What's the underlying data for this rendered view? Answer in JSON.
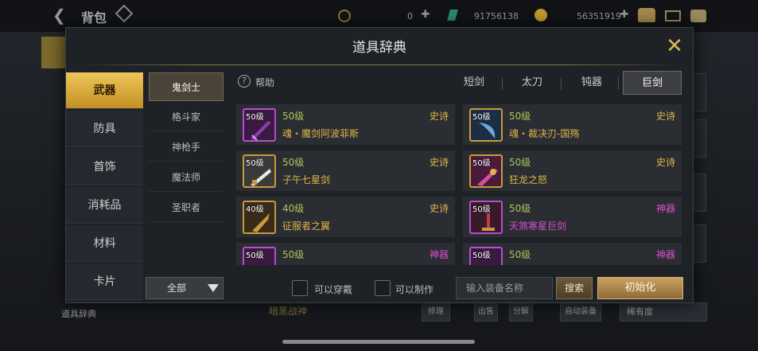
{
  "topbar": {
    "title": "背包",
    "currency_1": "0",
    "currency_2": "91756138",
    "currency_3": "56351919"
  },
  "background": {
    "bottom_left_label": "道具辞典",
    "bottom_label_2": "暗黑战神",
    "buttons": [
      "修理",
      "出售",
      "分解",
      "自动装备"
    ],
    "sort_label": "稀有度"
  },
  "dialog": {
    "title": "道具辞典",
    "categories": [
      "武器",
      "防具",
      "首饰",
      "消耗品",
      "材料",
      "卡片"
    ],
    "active_category": "武器",
    "classes": [
      "鬼剑士",
      "格斗家",
      "神枪手",
      "魔法师",
      "圣职者"
    ],
    "active_class": "鬼剑士",
    "help_label": "帮助",
    "weapon_tabs": [
      "短剑",
      "太刀",
      "钝器",
      "巨剑"
    ],
    "active_weapon_tab": "巨剑",
    "items": [
      {
        "level_badge": "50级",
        "level": "50级",
        "grade": "史诗",
        "name": "魂・魔剑阿波菲斯",
        "frame": "gold"
      },
      {
        "level_badge": "50级",
        "level": "50级",
        "grade": "史诗",
        "name": "魂・裁决刃-国殇",
        "frame": "gold"
      },
      {
        "level_badge": "50级",
        "level": "50级",
        "grade": "史诗",
        "name": "子午七星剑",
        "frame": "gold"
      },
      {
        "level_badge": "50级",
        "level": "50级",
        "grade": "史诗",
        "name": "狂龙之怒",
        "frame": "gold"
      },
      {
        "level_badge": "40级",
        "level": "40级",
        "grade": "史诗",
        "name": "征服者之翼",
        "frame": "gold"
      },
      {
        "level_badge": "50级",
        "level": "50级",
        "grade": "神器",
        "name": "天煞寒星巨剑",
        "frame": "purple"
      },
      {
        "level_badge": "50级",
        "level": "50级",
        "grade": "神器",
        "name": "",
        "frame": "purple"
      },
      {
        "level_badge": "50级",
        "level": "50级",
        "grade": "神器",
        "name": "",
        "frame": "purple"
      }
    ],
    "filter": {
      "dropdown_value": "全部",
      "can_wear_label": "可以穿戴",
      "can_craft_label": "可以制作",
      "search_placeholder": "输入装备名称",
      "search_button": "搜索",
      "reset_button": "初始化"
    },
    "colors": {
      "epic": "#e0b64a",
      "mythic": "#d84fd4",
      "level": "#a8c85a",
      "active_gold": "#f0c65a"
    }
  }
}
